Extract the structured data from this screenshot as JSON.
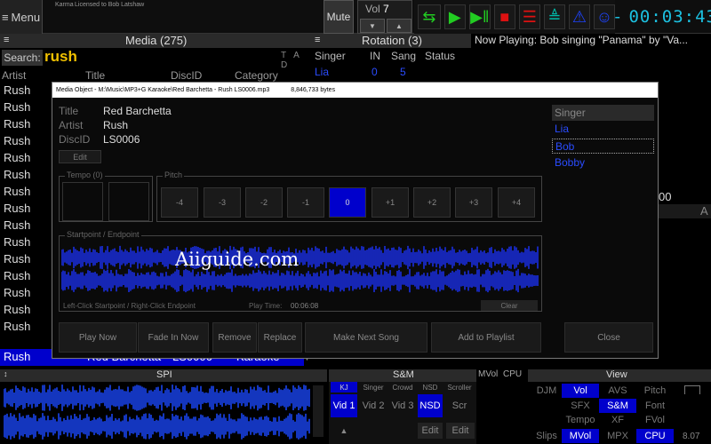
{
  "topbar": {
    "menu_label": "Menu",
    "karma_label": "Karma",
    "license_label": "Licensed to Bob Latshaw",
    "mute_label": "Mute",
    "vol_label": "Vol",
    "vol_value": "7",
    "clock": "00:03:43"
  },
  "media": {
    "header": "Media (275)",
    "search_label": "Search:",
    "search_value": "rush",
    "sort_letters": "T A D",
    "columns": [
      "Artist",
      "Title",
      "DiscID",
      "Category"
    ],
    "artist_rows": [
      "Rush",
      "Rush",
      "Rush",
      "Rush",
      "Rush",
      "Rush",
      "Rush",
      "Rush",
      "Rush",
      "Rush",
      "Rush",
      "Rush",
      "Rush",
      "Rush",
      "Rush",
      "Rush"
    ],
    "selected_row": {
      "artist": "Rush",
      "title": "Red Barchetta",
      "discid": "LS0006",
      "category": "Karaoke"
    }
  },
  "rotation": {
    "header": "Rotation (3)",
    "columns": [
      "Singer",
      "IN",
      "Sang",
      "Status"
    ],
    "first_row": {
      "singer": "Lia",
      "in": "0",
      "sang": "5"
    }
  },
  "now_playing": "Now Playing:  Bob singing \"Panama\" by \"Va...",
  "right_fragments": {
    "num": "00",
    "letter": "A"
  },
  "dialog": {
    "title": "Media Object - M:\\Music\\MP3+G Karaoke\\Red Barchetta - Rush LS0006.mp3",
    "size": "8,846,733 bytes",
    "title_label": "Title",
    "title_value": "Red Barchetta",
    "artist_label": "Artist",
    "artist_value": "Rush",
    "discid_label": "DiscID",
    "discid_value": "LS0006",
    "edit_label": "Edit",
    "singer_header": "Singer",
    "singers": [
      "Lia",
      "Bob",
      "Bobby"
    ],
    "tempo_legend": "Tempo (0)",
    "pitch_legend": "Pitch",
    "pitch_buttons": [
      "-4",
      "-3",
      "-2",
      "-1",
      "0",
      "+1",
      "+2",
      "+3",
      "+4"
    ],
    "pitch_selected": "0",
    "wave_legend": "Startpoint / Endpoint",
    "wave_hint": "Left-Click Startpoint / Right-Click Endpoint",
    "play_time_label": "Play Time:",
    "play_time_value": "00:06:08",
    "clear_label": "Clear",
    "actions": [
      "Play Now",
      "Fade In Now",
      "Remove",
      "Replace",
      "Make Next Song",
      "Add to Playlist"
    ],
    "close_label": "Close",
    "watermark": "Aiiguide.com"
  },
  "bottom": {
    "spi_header": "SPI",
    "sm_header": "S&M",
    "mvol_label": "MVol",
    "cpu_label": "CPU",
    "view_header": "View",
    "sm_tabs": [
      "KJ",
      "Singer",
      "Crowd",
      "NSD",
      "Scroller"
    ],
    "sm_buttons": [
      "Vid 1",
      "Vid 2",
      "Vid 3",
      "NSD",
      "Scr"
    ],
    "edit_labels": [
      "Edit",
      "Edit"
    ],
    "up_arrow": "▲",
    "view_grid": [
      [
        "DJM",
        "Vol",
        "AVS",
        "Pitch"
      ],
      [
        "",
        "SFX",
        "S&M",
        "Font"
      ],
      [
        "",
        "Tempo",
        "XF",
        "FVol"
      ],
      [
        "Slips",
        "MVol",
        "MPX",
        "CPU"
      ]
    ],
    "view_on": [
      "Vol",
      "S&M",
      "MVol",
      "CPU"
    ],
    "cpu_value": "8.07"
  },
  "colors": {
    "accent_blue": "#0000cc",
    "clock_cyan": "#1cc0e0",
    "search_yellow": "#f0c000",
    "link_blue": "#2a4cff"
  }
}
